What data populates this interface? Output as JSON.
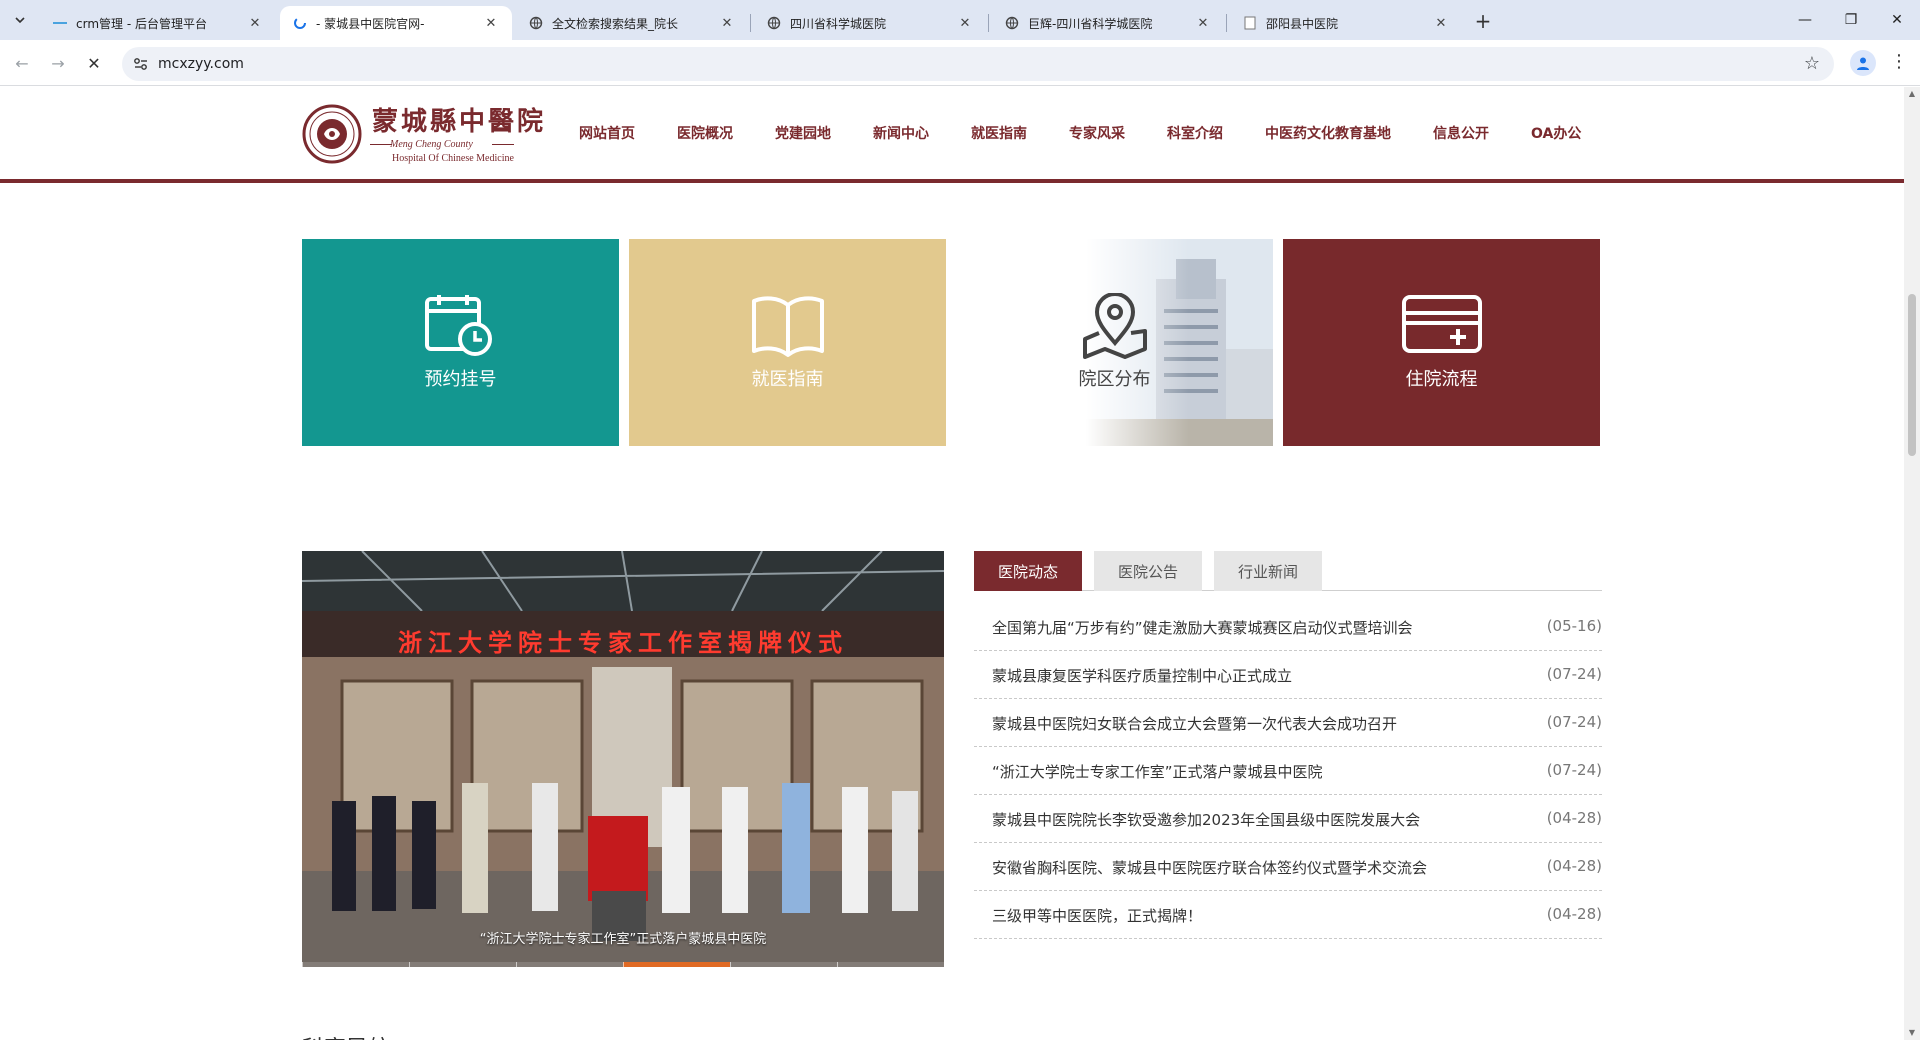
{
  "browser": {
    "tabs": [
      {
        "title": "crm管理 - 后台管理平台",
        "active": false
      },
      {
        "title": "- 蒙城县中医院官网-",
        "active": true
      },
      {
        "title": "全文检索搜索结果_院长",
        "active": false
      },
      {
        "title": "四川省科学城医院",
        "active": false
      },
      {
        "title": "巨辉-四川省科学城医院",
        "active": false
      },
      {
        "title": "邵阳县中医院",
        "active": false
      }
    ],
    "new_tab": "+",
    "url": "mcxzyy.com",
    "window": {
      "minimize": "—",
      "restore": "❐",
      "close": "✕"
    }
  },
  "site": {
    "logo": {
      "cn": "蒙城縣中醫院",
      "en_line1": "Meng Cheng County",
      "en_line2": "Hospital Of Chinese Medicine"
    },
    "nav": [
      "网站首页",
      "医院概况",
      "党建园地",
      "新闻中心",
      "就医指南",
      "专家风采",
      "科室介绍",
      "中医药文化教育基地",
      "信息公开",
      "OA办公"
    ],
    "tiles": [
      {
        "label": "预约挂号",
        "icon": "calendar-clock-icon",
        "bg": "#139790",
        "fg": "#ffffff"
      },
      {
        "label": "就医指南",
        "icon": "book-open-icon",
        "bg": "#e2c98e",
        "fg": "#ffffff"
      },
      {
        "label": "院区分布",
        "icon": "map-pin-icon",
        "bg": "#ffffff",
        "fg": "#444444"
      },
      {
        "label": "住院流程",
        "icon": "card-plus-icon",
        "bg": "#78292c",
        "fg": "#ffffff"
      }
    ],
    "slider": {
      "banner_text": "浙江大学院士专家工作室揭牌仪式",
      "caption": "“浙江大学院士专家工作室”正式落户蒙城县中医院"
    },
    "news_tabs": [
      "医院动态",
      "医院公告",
      "行业新闻"
    ],
    "news": [
      {
        "title": "全国第九届“万步有约”健走激励大赛蒙城赛区启动仪式暨培训会",
        "date": "(05-16)"
      },
      {
        "title": "蒙城县康复医学科医疗质量控制中心正式成立",
        "date": "(07-24)"
      },
      {
        "title": "蒙城县中医院妇女联合会成立大会暨第一次代表大会成功召开",
        "date": "(07-24)"
      },
      {
        "title": "“浙江大学院士专家工作室”正式落户蒙城县中医院",
        "date": "(07-24)"
      },
      {
        "title": "蒙城县中医院院长李钦受邀参加2023年全国县级中医院发展大会",
        "date": "(04-28)"
      },
      {
        "title": "安徽省胸科医院、蒙城县中医院医疗联合体签约仪式暨学术交流会",
        "date": "(04-28)"
      },
      {
        "title": "三级甲等中医医院，正式揭牌！",
        "date": "(04-28)"
      }
    ],
    "section_title": "科室导航"
  },
  "colors": {
    "brand": "#7a2a2e",
    "teal": "#139790",
    "sand": "#e2c98e",
    "slider_active": "#e06a24"
  }
}
